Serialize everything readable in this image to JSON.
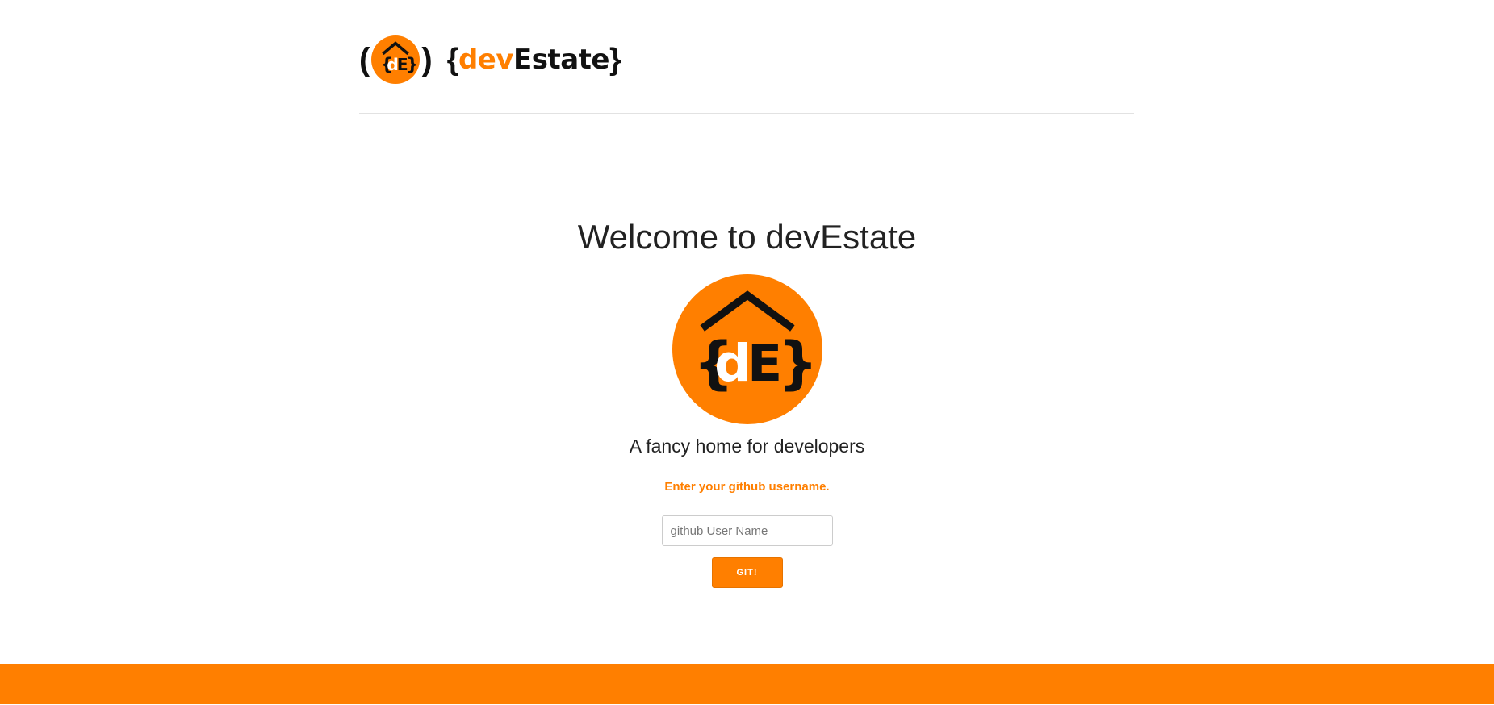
{
  "header": {
    "logo": {
      "left_paren": "(",
      "right_paren": ")",
      "icon": "devestate-house-logo-icon",
      "text_open_brace": "{",
      "text_accent": "dev",
      "text_main": "Estate",
      "text_close_brace": "}"
    }
  },
  "hero": {
    "title": "Welcome to devEstate",
    "logo_icon": "devestate-house-logo-icon",
    "tagline": "A fancy home for developers",
    "prompt": "Enter your github username.",
    "input_placeholder": "github User Name",
    "input_value": "",
    "button_label": "GIT!"
  },
  "colors": {
    "accent": "#ff7f00",
    "text": "#222222",
    "divider": "#e2e2e2"
  }
}
